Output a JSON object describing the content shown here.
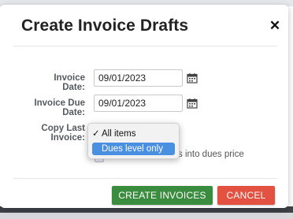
{
  "dialog": {
    "title": "Create Invoice Drafts",
    "close_icon": "close-icon"
  },
  "form": {
    "invoice_date_label": "Invoice Date:",
    "invoice_date_value": "09/01/2023",
    "invoice_due_date_label": "Invoice Due Date:",
    "invoice_due_date_value": "09/01/2023",
    "copy_last_invoice_label": "Copy Last Invoice:",
    "calendar_icon": "calendar-icon",
    "checkbox_partial_text": "s into dues price"
  },
  "dropdown": {
    "options": [
      {
        "label": "All items",
        "checked": true
      },
      {
        "label": "Dues level only",
        "checked": false,
        "highlighted": true
      }
    ],
    "check_glyph": "✓"
  },
  "buttons": {
    "create_label": "CREATE INVOICES",
    "cancel_label": "CANCEL"
  },
  "colors": {
    "create": "#3a8d3e",
    "cancel": "#e35140",
    "highlight": "#4a90e2"
  }
}
